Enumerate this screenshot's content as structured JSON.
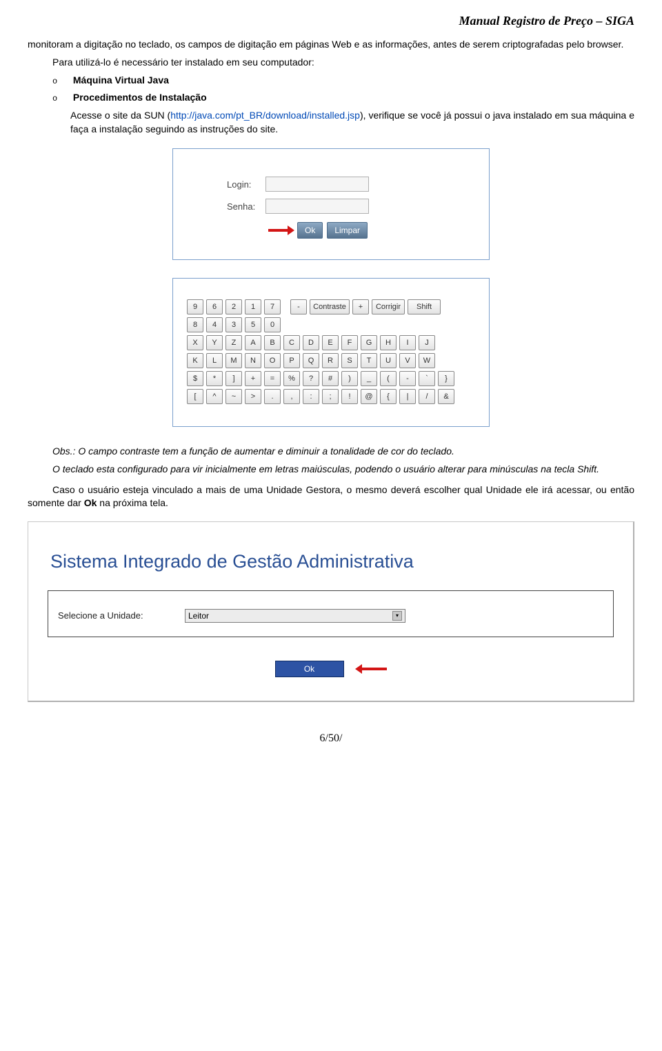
{
  "header": {
    "title": "Manual Registro de Preço – SIGA"
  },
  "paragraphs": {
    "p1": "monitoram a digitação no teclado, os campos de digitação em páginas Web e as informações, antes de serem criptografadas pelo browser.",
    "p2_prefix": "Para utilizá-lo é necessário ter instalado em seu computador:",
    "bullet1": "Máquina Virtual Java",
    "bullet2": "Procedimentos de Instalação",
    "p3_a": "Acesse o site da SUN (",
    "p3_link": "http://java.com/pt_BR/download/installed.jsp",
    "p3_b": "), verifique se você já possui o java instalado em sua máquina e faça a instalação seguindo as instruções do site.",
    "obs": "Obs.: O campo contraste tem a função de aumentar e diminuir a tonalidade de cor do teclado.",
    "keyboard_note": "O teclado esta configurado para vir inicialmente em letras maiúsculas, podendo o usuário alterar para minúsculas na tecla Shift.",
    "unit_note_a": "Caso o usuário esteja vinculado a mais de uma Unidade Gestora, o mesmo deverá escolher qual Unidade ele irá acessar, ou então somente dar ",
    "unit_note_bold": "Ok",
    "unit_note_b": " na próxima tela."
  },
  "login": {
    "login_label": "Login:",
    "senha_label": "Senha:",
    "ok": "Ok",
    "limpar": "Limpar"
  },
  "keyboard": {
    "row1_nums": [
      "9",
      "6",
      "2",
      "1",
      "7"
    ],
    "row1_controls": [
      "-",
      "Contraste",
      "+",
      "Corrigir",
      "Shift"
    ],
    "row2_nums": [
      "8",
      "4",
      "3",
      "5",
      "0"
    ],
    "row3": [
      "X",
      "Y",
      "Z",
      "A",
      "B",
      "C",
      "D",
      "E",
      "F",
      "G",
      "H",
      "I",
      "J"
    ],
    "row4": [
      "K",
      "L",
      "M",
      "N",
      "O",
      "P",
      "Q",
      "R",
      "S",
      "T",
      "U",
      "V",
      "W"
    ],
    "row5": [
      "$",
      "*",
      "]",
      "+",
      "=",
      "%",
      "?",
      "#",
      ")",
      "_",
      "(",
      "-",
      "`",
      "}"
    ],
    "row6": [
      "[",
      "^",
      "~",
      ">",
      ".",
      ",",
      ":",
      ";",
      "!",
      "@",
      "{",
      "|",
      "/",
      "&"
    ]
  },
  "unit": {
    "title": "Sistema Integrado de Gestão Administrativa",
    "label": "Selecione a Unidade:",
    "value": "Leitor",
    "ok": "Ok"
  },
  "page_number": "6/50/"
}
